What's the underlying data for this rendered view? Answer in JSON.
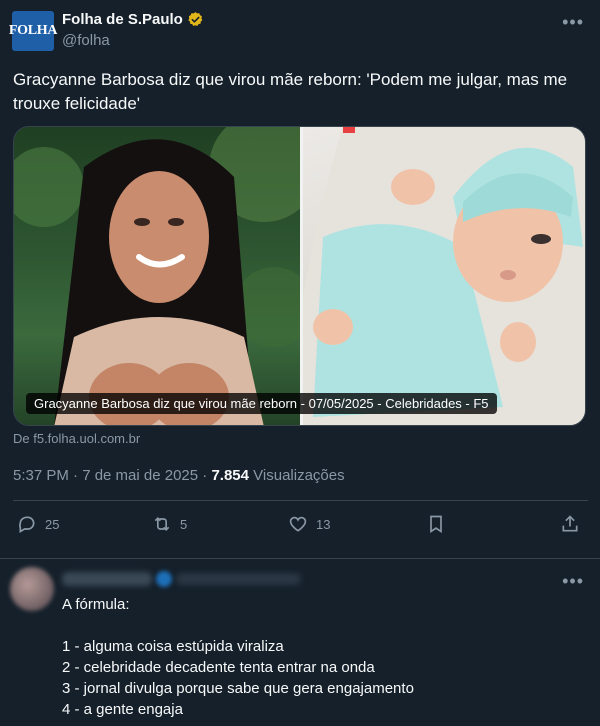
{
  "tweet": {
    "author_name": "Folha de S.Paulo",
    "author_handle": "@folha",
    "avatar_logo_text": "FOLHA",
    "text": "Gracyanne Barbosa diz que virou mãe reborn: 'Podem me julgar, mas me trouxe felicidade'",
    "media_caption": "Gracyanne Barbosa diz que virou mãe reborn - 07/05/2025 - Celebridades - F5",
    "link_source": "De f5.folha.uol.com.br",
    "timestamp": "5:37 PM · 7 de mai de 2025 ·",
    "views_count": "7.854",
    "views_label": "Visualizações",
    "actions": {
      "reply_count": "25",
      "retweet_count": "5",
      "like_count": "13"
    }
  },
  "reply": {
    "intro": "A fórmula:",
    "items": [
      "1 - alguma coisa estúpida viraliza",
      "2 - celebridade decadente tenta entrar na onda",
      "3 - jornal divulga porque sabe que gera engajamento",
      "4 - a gente engaja"
    ]
  },
  "icons": {
    "verified": "verified-badge-icon",
    "more": "more-icon",
    "reply": "reply-icon",
    "retweet": "retweet-icon",
    "like": "like-icon",
    "bookmark": "bookmark-icon",
    "share": "share-icon"
  },
  "colors": {
    "background": "#15202b",
    "text": "#f7f9f9",
    "muted": "#8b98a5",
    "verified_gold": "#e2b719",
    "border": "#38444d"
  }
}
